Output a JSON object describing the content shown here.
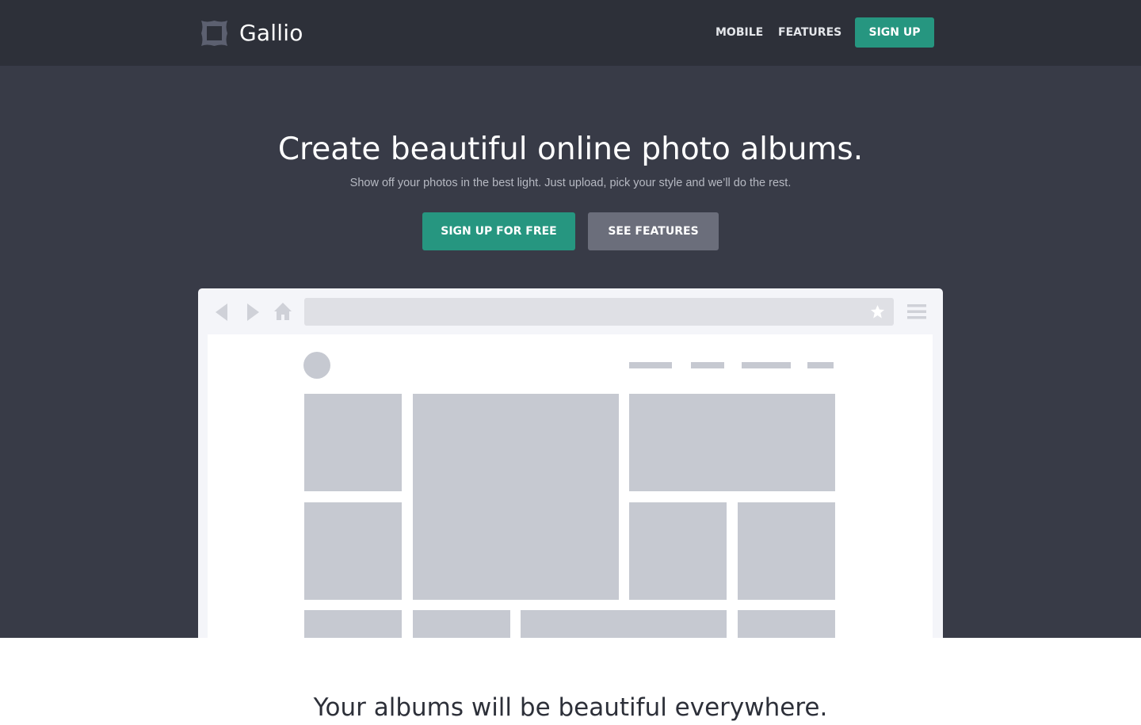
{
  "header": {
    "brand": "Gallio",
    "nav": {
      "mobile": "MOBILE",
      "features": "FEATURES"
    },
    "signup_label": "SIGN UP"
  },
  "hero": {
    "title": "Create beautiful online photo albums.",
    "subtitle": "Show off your photos in the best light.  Just upload, pick your style and we’ll do the rest.",
    "primary_cta": "SIGN UP FOR FREE",
    "secondary_cta": "SEE FEATURES"
  },
  "mockup": {
    "icons": [
      "back-arrow-icon",
      "forward-arrow-icon",
      "home-icon",
      "star-icon",
      "hamburger-menu-icon"
    ]
  },
  "section2": {
    "title": "Your albums will be beautiful everywhere."
  },
  "colors": {
    "header_bg": "#2d3039",
    "hero_bg": "#383b47",
    "accent": "#269680",
    "secondary_button": "#6b6e7b",
    "placeholder": "#c6c9d1"
  }
}
